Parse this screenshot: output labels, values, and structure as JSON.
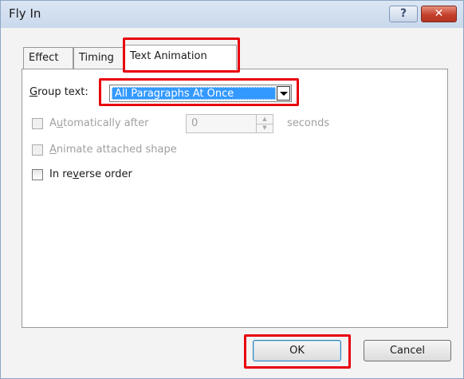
{
  "window": {
    "title": "Fly In",
    "help_glyph": "?",
    "close_glyph": "✕"
  },
  "tabs": [
    {
      "label": "Effect"
    },
    {
      "label": "Timing"
    },
    {
      "label": "Text Animation"
    }
  ],
  "group_text": {
    "label_pre": "G",
    "label_post": "roup text:",
    "selected": "All Paragraphs At Once"
  },
  "auto_after": {
    "label_pre": "A",
    "label_mid": "u",
    "label_post": "tomatically after",
    "value": "0",
    "unit": "seconds",
    "checked": false,
    "enabled": false
  },
  "animate_shape": {
    "label_pre": "A",
    "label_post": "nimate attached shape",
    "checked": false,
    "enabled": false
  },
  "reverse_order": {
    "label_pre": "In re",
    "label_mid": "v",
    "label_post": "erse order",
    "checked": false,
    "enabled": true
  },
  "buttons": {
    "ok": "OK",
    "cancel": "Cancel"
  },
  "colors": {
    "highlight": "#e8000b",
    "selection": "#3399ff",
    "close": "#c4402c"
  }
}
